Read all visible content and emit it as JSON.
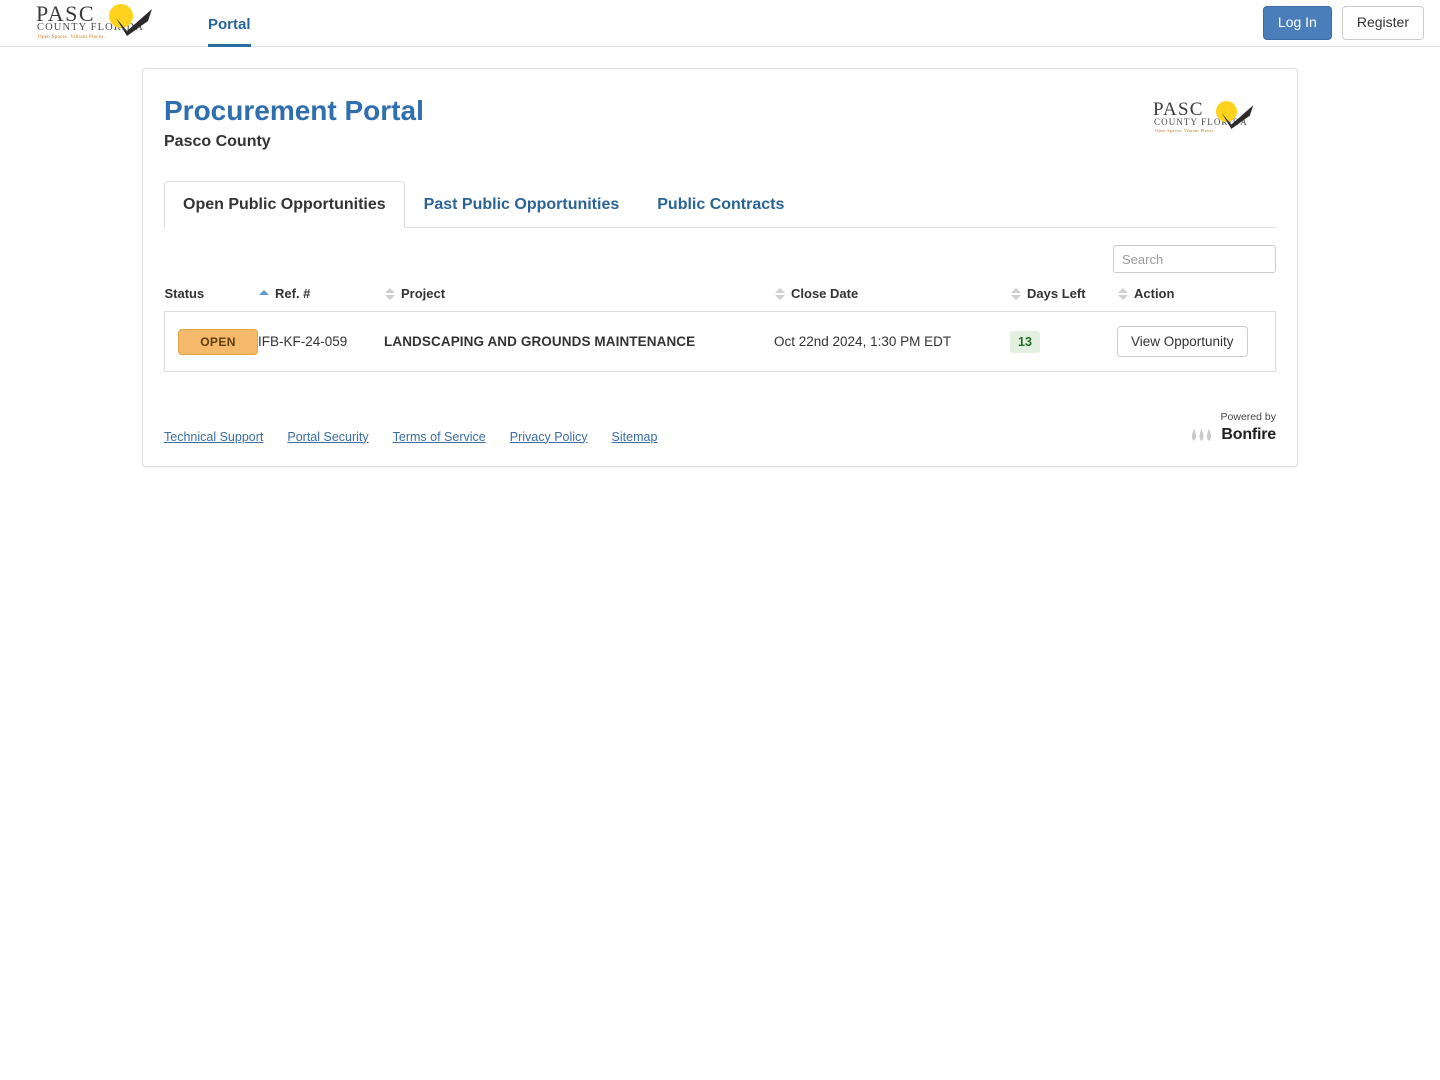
{
  "navbar": {
    "logo_alt": "Pasco County Florida",
    "logo_line1": "PASC",
    "logo_line2": "COUNTY FLORIDA",
    "logo_tagline": "Open Spaces. Vibrant Places.",
    "portal_tab": "Portal",
    "login_label": "Log In",
    "register_label": "Register"
  },
  "header": {
    "title": "Procurement Portal",
    "subtitle": "Pasco County",
    "logo_line1": "PASC",
    "logo_line2": "COUNTY FLORIDA",
    "logo_tagline": "Open Spaces. Vibrant Places."
  },
  "tabs": [
    {
      "label": "Open Public Opportunities",
      "active": true
    },
    {
      "label": "Past Public Opportunities",
      "active": false
    },
    {
      "label": "Public Contracts",
      "active": false
    }
  ],
  "search": {
    "placeholder": "Search",
    "value": ""
  },
  "table": {
    "columns": [
      {
        "label": "Status",
        "sort": "asc"
      },
      {
        "label": "Ref. #",
        "sort": "none"
      },
      {
        "label": "Project",
        "sort": "none"
      },
      {
        "label": "Close Date",
        "sort": "none"
      },
      {
        "label": "Days Left",
        "sort": "none"
      },
      {
        "label": "Action",
        "sort": "none"
      }
    ],
    "rows": [
      {
        "status": "OPEN",
        "ref": "IFB-KF-24-059",
        "project": "LANDSCAPING AND GROUNDS MAINTENANCE",
        "close_date": "Oct 22nd 2024, 1:30 PM EDT",
        "days_left": "13",
        "action_label": "View Opportunity"
      }
    ]
  },
  "footer": {
    "links": [
      "Technical Support",
      "Portal Security",
      "Terms of Service",
      "Privacy Policy",
      "Sitemap"
    ],
    "powered_by": "Powered by",
    "powered_brand": "Bonfire"
  },
  "colors": {
    "brand_blue": "#2f6fad",
    "link_blue": "#3a6ea5",
    "primary_button": "#4a7ebb",
    "status_open_bg": "#f5b96b",
    "days_left_bg": "#e3f0df",
    "days_left_text": "#1e6b24",
    "logo_yellow": "#ffd21e"
  }
}
